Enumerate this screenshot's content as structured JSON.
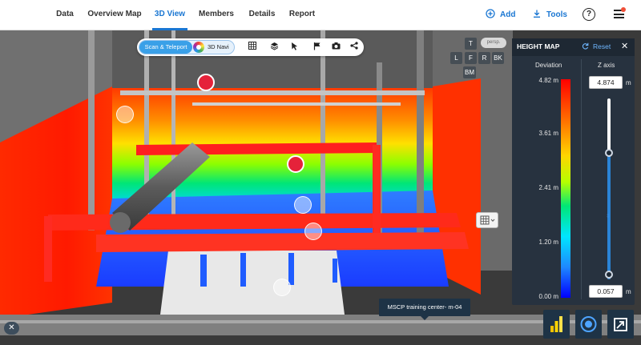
{
  "nav": {
    "tabs": [
      {
        "label": "Data"
      },
      {
        "label": "Overview Map"
      },
      {
        "label": "3D View"
      },
      {
        "label": "Members"
      },
      {
        "label": "Details"
      },
      {
        "label": "Report"
      }
    ],
    "active_tab": "3D View",
    "add_label": "Add",
    "tools_label": "Tools",
    "help_label": "?"
  },
  "toolbar": {
    "scan_label": "Scan & Teleport",
    "navi_label": "3D Navi"
  },
  "view_cube": {
    "persp_label": "persp.",
    "top": "T",
    "left": "L",
    "front": "F",
    "right": "R",
    "back": "BK",
    "bottom": "BM"
  },
  "height_map": {
    "title": "HEIGHT MAP",
    "reset_label": "Reset",
    "deviation_label": "Deviation",
    "zaxis_label": "Z axis",
    "ticks": [
      "4.82 m",
      "3.61 m",
      "2.41 m",
      "1.20 m",
      "0.00 m"
    ],
    "z_max": "4.874",
    "z_min": "0.057",
    "unit": "m",
    "slider_range_fraction": [
      0.0,
      0.7
    ]
  },
  "tooltip": {
    "text": "MSCP training center- m-04"
  },
  "colors": {
    "accent": "#1976d2",
    "panel": "#27323f",
    "marker": "#e5223a"
  }
}
